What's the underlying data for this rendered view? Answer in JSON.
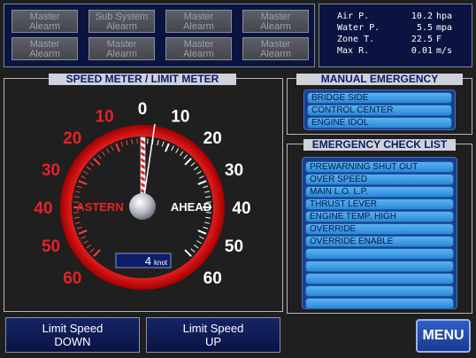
{
  "alarms": [
    {
      "line1": "Master",
      "line2": "Alearm"
    },
    {
      "line1": "Sub System",
      "line2": "Alearm"
    },
    {
      "line1": "Master",
      "line2": "Alearm"
    },
    {
      "line1": "Master",
      "line2": "Alearm"
    },
    {
      "line1": "Master",
      "line2": "Alearm"
    },
    {
      "line1": "Master",
      "line2": "Alearm"
    },
    {
      "line1": "Master",
      "line2": "Alearm"
    },
    {
      "line1": "Master",
      "line2": "Alearm"
    }
  ],
  "status": [
    {
      "label": "Air P.",
      "value": "10.2",
      "unit": "hpa"
    },
    {
      "label": "Water P.",
      "value": "5.5",
      "unit": "mpa"
    },
    {
      "label": "Zone T.",
      "value": "22.5",
      "unit": "F"
    },
    {
      "label": "Max R.",
      "value": "0.01",
      "unit": "m/s"
    }
  ],
  "meter": {
    "title": "SPEED METER / LIMIT METER",
    "astern_label": "ASTERN",
    "ahead_label": "AHEAD",
    "astern_ticks": [
      "10",
      "20",
      "30",
      "40",
      "50",
      "60"
    ],
    "ahead_ticks": [
      "10",
      "20",
      "30",
      "40",
      "50",
      "60"
    ],
    "zero_label": "0",
    "speed_value": "4",
    "speed_unit": "knot",
    "needle_value": 0,
    "max": 60,
    "astern_color": "#e8202a",
    "ahead_color": "#ffffff"
  },
  "manual_emergency": {
    "title": "MANUAL EMERGENCY",
    "items": [
      "BRIDGE SIDE",
      "CONTROL CENTER",
      "ENGINE IDOL"
    ]
  },
  "check_list": {
    "title": "EMERGENCY CHECK LIST",
    "items": [
      "PREWARNING SHUT OUT",
      "OVER SPEED",
      "MAIN L.O. L.P.",
      "THRUST LEVER",
      "ENGINE TEMP. HIGH",
      "OVERRIDE",
      "OVERRIDE ENABLE",
      "",
      "",
      "",
      "",
      ""
    ]
  },
  "buttons": {
    "limit_down_line1": "Limit Speed",
    "limit_down_line2": "DOWN",
    "limit_up_line1": "Limit Speed",
    "limit_up_line2": "UP",
    "menu": "MENU"
  }
}
